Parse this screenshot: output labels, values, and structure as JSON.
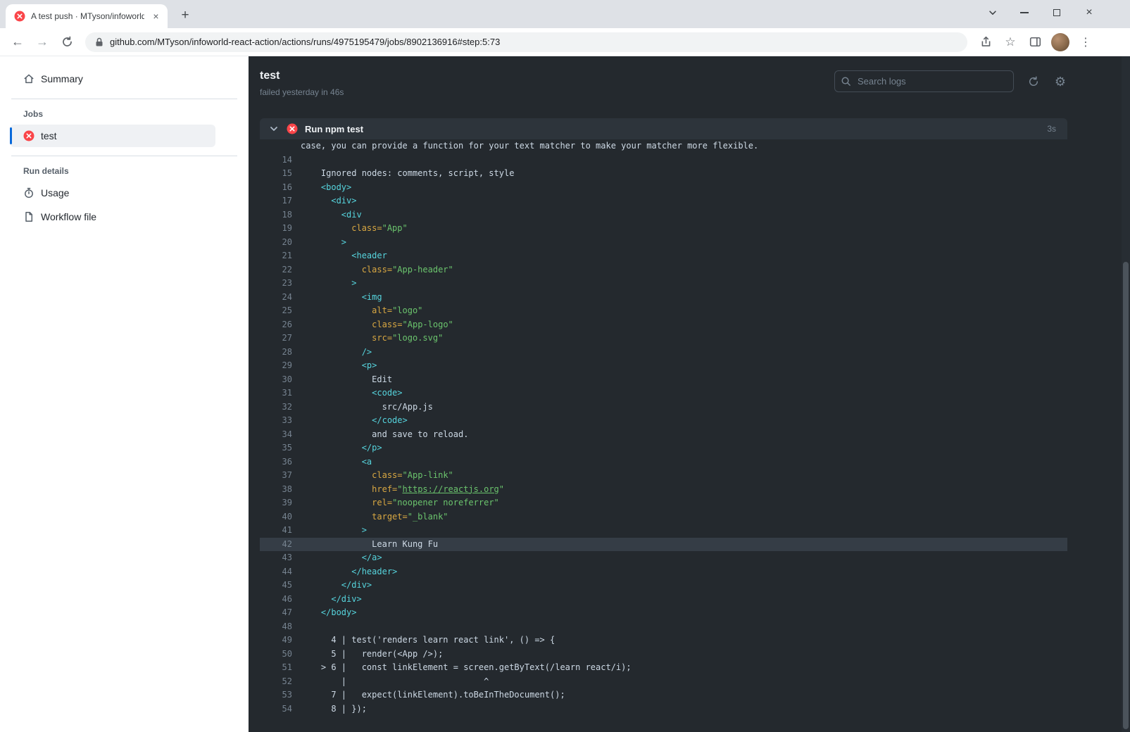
{
  "browser": {
    "tab_title": "A test push · MTyson/infoworld-",
    "url": "github.com/MTyson/infoworld-react-action/actions/runs/4975195479/jobs/8902136916#step:5:73"
  },
  "icons": {
    "back": "←",
    "forward": "→",
    "star": "☆",
    "kebab": "⋮",
    "gear": "⚙",
    "new_tab": "+",
    "tab_close": "×",
    "window_close": "×"
  },
  "colors": {
    "accent": "#0969da",
    "error": "#fa4549",
    "log_bg": "#24292e",
    "tok_tag": "#56d4dd",
    "tok_attr": "#d9a842",
    "tok_val": "#6bc46d",
    "tok_plain": "#cdd9e5"
  },
  "sidebar": {
    "summary": "Summary",
    "jobs_header": "Jobs",
    "job_test": "test",
    "run_details_header": "Run details",
    "usage": "Usage",
    "workflow_file": "Workflow file"
  },
  "main": {
    "title": "test",
    "subtitle": "failed yesterday in 46s",
    "search_placeholder": "Search logs",
    "step_title": "Run npm test",
    "step_duration": "3s"
  },
  "log_lines": [
    {
      "n": "",
      "toks": [
        [
          "case, you can provide a function for your text matcher to make your matcher more flexible.",
          "p"
        ]
      ]
    },
    {
      "n": "14",
      "toks": []
    },
    {
      "n": "15",
      "toks": [
        [
          "    Ignored nodes: comments, script, style",
          "p"
        ]
      ]
    },
    {
      "n": "16",
      "toks": [
        [
          "    ",
          "p"
        ],
        [
          "<body>",
          "t"
        ]
      ]
    },
    {
      "n": "17",
      "toks": [
        [
          "      ",
          "p"
        ],
        [
          "<div>",
          "t"
        ]
      ]
    },
    {
      "n": "18",
      "toks": [
        [
          "        ",
          "p"
        ],
        [
          "<div",
          "t"
        ]
      ]
    },
    {
      "n": "19",
      "toks": [
        [
          "          ",
          "p"
        ],
        [
          "class=",
          "a"
        ],
        [
          "\"App\"",
          "v"
        ]
      ]
    },
    {
      "n": "20",
      "toks": [
        [
          "        ",
          "p"
        ],
        [
          ">",
          "t"
        ]
      ]
    },
    {
      "n": "21",
      "toks": [
        [
          "          ",
          "p"
        ],
        [
          "<header",
          "t"
        ]
      ]
    },
    {
      "n": "22",
      "toks": [
        [
          "            ",
          "p"
        ],
        [
          "class=",
          "a"
        ],
        [
          "\"App-header\"",
          "v"
        ]
      ]
    },
    {
      "n": "23",
      "toks": [
        [
          "          ",
          "p"
        ],
        [
          ">",
          "t"
        ]
      ]
    },
    {
      "n": "24",
      "toks": [
        [
          "            ",
          "p"
        ],
        [
          "<img",
          "t"
        ]
      ]
    },
    {
      "n": "25",
      "toks": [
        [
          "              ",
          "p"
        ],
        [
          "alt=",
          "a"
        ],
        [
          "\"logo\"",
          "v"
        ]
      ]
    },
    {
      "n": "26",
      "toks": [
        [
          "              ",
          "p"
        ],
        [
          "class=",
          "a"
        ],
        [
          "\"App-logo\"",
          "v"
        ]
      ]
    },
    {
      "n": "27",
      "toks": [
        [
          "              ",
          "p"
        ],
        [
          "src=",
          "a"
        ],
        [
          "\"logo.svg\"",
          "v"
        ]
      ]
    },
    {
      "n": "28",
      "toks": [
        [
          "            ",
          "p"
        ],
        [
          "/>",
          "t"
        ]
      ]
    },
    {
      "n": "29",
      "toks": [
        [
          "            ",
          "p"
        ],
        [
          "<p>",
          "t"
        ]
      ]
    },
    {
      "n": "30",
      "toks": [
        [
          "              Edit",
          "p"
        ]
      ]
    },
    {
      "n": "31",
      "toks": [
        [
          "              ",
          "p"
        ],
        [
          "<code>",
          "t"
        ]
      ]
    },
    {
      "n": "32",
      "toks": [
        [
          "                src/App.js",
          "p"
        ]
      ]
    },
    {
      "n": "33",
      "toks": [
        [
          "              ",
          "p"
        ],
        [
          "</code>",
          "t"
        ]
      ]
    },
    {
      "n": "34",
      "toks": [
        [
          "              and save to reload.",
          "p"
        ]
      ]
    },
    {
      "n": "35",
      "toks": [
        [
          "            ",
          "p"
        ],
        [
          "</p>",
          "t"
        ]
      ]
    },
    {
      "n": "36",
      "toks": [
        [
          "            ",
          "p"
        ],
        [
          "<a",
          "t"
        ]
      ]
    },
    {
      "n": "37",
      "toks": [
        [
          "              ",
          "p"
        ],
        [
          "class=",
          "a"
        ],
        [
          "\"App-link\"",
          "v"
        ]
      ]
    },
    {
      "n": "38",
      "toks": [
        [
          "              ",
          "p"
        ],
        [
          "href=",
          "a"
        ],
        [
          "\"",
          "v"
        ],
        [
          "https://reactjs.org",
          "l"
        ],
        [
          "\"",
          "v"
        ]
      ]
    },
    {
      "n": "39",
      "toks": [
        [
          "              ",
          "p"
        ],
        [
          "rel=",
          "a"
        ],
        [
          "\"noopener noreferrer\"",
          "v"
        ]
      ]
    },
    {
      "n": "40",
      "toks": [
        [
          "              ",
          "p"
        ],
        [
          "target=",
          "a"
        ],
        [
          "\"_blank\"",
          "v"
        ]
      ]
    },
    {
      "n": "41",
      "toks": [
        [
          "            ",
          "p"
        ],
        [
          ">",
          "t"
        ]
      ]
    },
    {
      "n": "42",
      "hl": true,
      "toks": [
        [
          "              Learn Kung Fu",
          "p"
        ]
      ]
    },
    {
      "n": "43",
      "toks": [
        [
          "            ",
          "p"
        ],
        [
          "</a>",
          "t"
        ]
      ]
    },
    {
      "n": "44",
      "toks": [
        [
          "          ",
          "p"
        ],
        [
          "</header>",
          "t"
        ]
      ]
    },
    {
      "n": "45",
      "toks": [
        [
          "        ",
          "p"
        ],
        [
          "</div>",
          "t"
        ]
      ]
    },
    {
      "n": "46",
      "toks": [
        [
          "      ",
          "p"
        ],
        [
          "</div>",
          "t"
        ]
      ]
    },
    {
      "n": "47",
      "toks": [
        [
          "    ",
          "p"
        ],
        [
          "</body>",
          "t"
        ]
      ]
    },
    {
      "n": "48",
      "toks": []
    },
    {
      "n": "49",
      "toks": [
        [
          "      4 | test('renders learn react link', () => {",
          "p"
        ]
      ]
    },
    {
      "n": "50",
      "toks": [
        [
          "      5 |   render(<App />);",
          "p"
        ]
      ]
    },
    {
      "n": "51",
      "toks": [
        [
          "    > 6 |   const linkElement = screen.getByText(/learn react/i);",
          "p"
        ]
      ]
    },
    {
      "n": "52",
      "toks": [
        [
          "        |                           ^",
          "p"
        ]
      ]
    },
    {
      "n": "53",
      "toks": [
        [
          "      7 |   expect(linkElement).toBeInTheDocument();",
          "p"
        ]
      ]
    },
    {
      "n": "54",
      "toks": [
        [
          "      8 | });",
          "p"
        ]
      ]
    }
  ]
}
